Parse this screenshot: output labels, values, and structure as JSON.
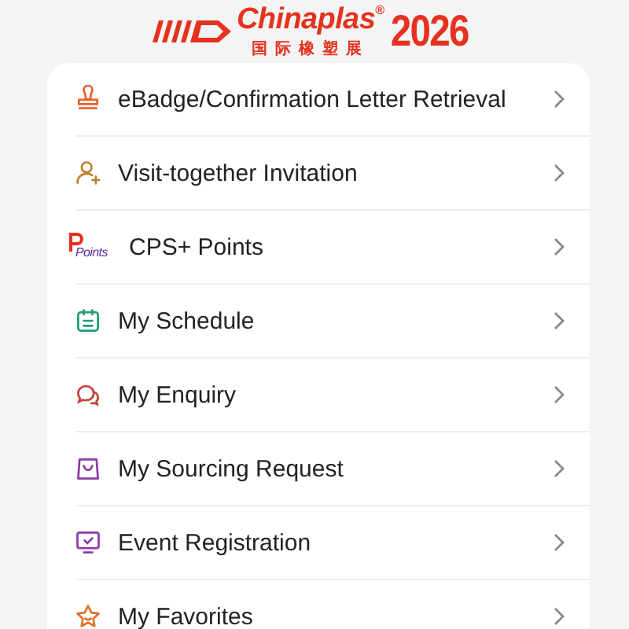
{
  "logo": {
    "name": "Chinaplas",
    "mark": "®",
    "subtitle": "国际橡塑展",
    "year": "2026"
  },
  "menu": [
    {
      "kind": "badge",
      "label": "eBadge/Confirmation Letter Retrieval"
    },
    {
      "kind": "invite",
      "label": "Visit-together Invitation"
    },
    {
      "kind": "points",
      "label": "CPS+ Points",
      "icon_text": "Points"
    },
    {
      "kind": "schedule",
      "label": "My Schedule"
    },
    {
      "kind": "enquiry",
      "label": "My Enquiry"
    },
    {
      "kind": "sourcing",
      "label": "My Sourcing Request"
    },
    {
      "kind": "event",
      "label": "Event Registration"
    },
    {
      "kind": "favorites",
      "label": "My Favorites"
    }
  ]
}
